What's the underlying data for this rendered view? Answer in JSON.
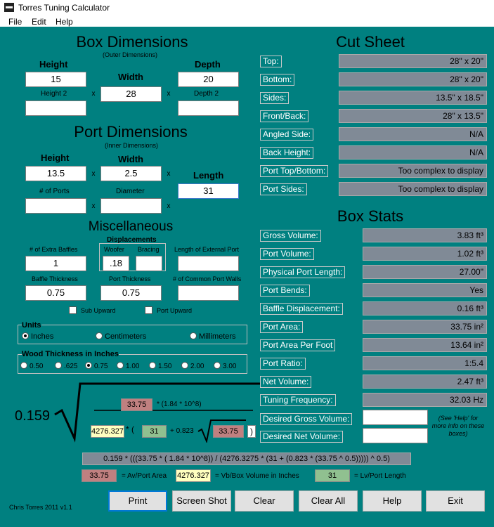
{
  "window": {
    "title": "Torres Tuning Calculator"
  },
  "menu": {
    "file": "File",
    "edit": "Edit",
    "help": "Help"
  },
  "box": {
    "title": "Box Dimensions",
    "subtitle": "(Outer Dimensions)",
    "height_label": "Height",
    "width_label": "Width",
    "depth_label": "Depth",
    "height2_label": "Height 2",
    "depth2_label": "Depth 2",
    "height": "15",
    "width": "28",
    "depth": "20",
    "height2": "",
    "depth2": "",
    "x": "x"
  },
  "port": {
    "title": "Port Dimensions",
    "subtitle": "(Inner Dimensions)",
    "height_label": "Height",
    "width_label": "Width",
    "length_label": "Length",
    "ports_label": "# of Ports",
    "diameter_label": "Diameter",
    "height": "13.5",
    "width": "2.5",
    "length": "31",
    "ports": "",
    "diameter": ""
  },
  "misc": {
    "title": "Miscellaneous",
    "displacements": "Displacements",
    "extra_baffles_label": "# of Extra Baffles",
    "woofer_label": "Woofer",
    "bracing_label": "Bracing",
    "ext_port_label": "Length of External Port",
    "baffle_thick_label": "Baffle Thickness",
    "port_thick_label": "Port Thickness",
    "common_walls_label": "# of Common Port Walls",
    "extra_baffles": "1",
    "woofer": ".18",
    "bracing": "",
    "ext_port": "",
    "baffle_thick": "0.75",
    "port_thick": "0.75",
    "common_walls": "",
    "sub_upward": "Sub Upward",
    "port_upward": "Port Upward"
  },
  "units": {
    "title": "Units",
    "options": [
      "Inches",
      "Centimeters",
      "Millimeters"
    ],
    "selected": "Inches"
  },
  "wood": {
    "title": "Wood Thickness in Inches",
    "options": [
      "0.50",
      ".625",
      "0.75",
      "1.00",
      "1.50",
      "2.00",
      "3.00"
    ],
    "selected": "0.75"
  },
  "cut": {
    "title": "Cut Sheet",
    "rows": [
      {
        "label": "Top:",
        "value": "28\" x 20\""
      },
      {
        "label": "Bottom:",
        "value": "28\" x 20\""
      },
      {
        "label": "Sides:",
        "value": "13.5\" x 18.5\""
      },
      {
        "label": "Front/Back:",
        "value": "28\" x 13.5\""
      },
      {
        "label": "Angled Side:",
        "value": "N/A"
      },
      {
        "label": "Back Height:",
        "value": "N/A"
      },
      {
        "label": "Port Top/Bottom:",
        "value": "Too complex to display"
      },
      {
        "label": "Port Sides:",
        "value": "Too complex to display"
      }
    ]
  },
  "stats": {
    "title": "Box Stats",
    "rows": [
      {
        "label": "Gross Volume:",
        "value": "3.83 ft³"
      },
      {
        "label": "Port Volume:",
        "value": "1.02 ft³"
      },
      {
        "label": "Physical Port Length:",
        "value": "27.00\""
      },
      {
        "label": "Port Bends:",
        "value": "Yes"
      },
      {
        "label": "Baffle Displacement:",
        "value": "0.16 ft³"
      },
      {
        "label": "Port Area:",
        "value": "33.75 in²"
      },
      {
        "label": "Port Area Per Foot",
        "value": "13.64 in²"
      },
      {
        "label": "Port Ratio:",
        "value": "1:5.4"
      },
      {
        "label": "Net Volume:",
        "value": "2.47 ft³"
      },
      {
        "label": "Tuning Frequency:",
        "value": "32.03 Hz"
      }
    ],
    "desired_gross": "Desired Gross Volume:",
    "desired_net": "Desired Net Volume:",
    "help_note": "(See 'Help' for more info on these boxes)"
  },
  "formula": {
    "const": "0.159",
    "av": "33.75",
    "factor": "* (1.84 * 10^8)",
    "vb": "4276.327",
    "open": "* (",
    "lv": "31",
    "plus": "+ 0.823",
    "av2": "33.75",
    "close": ")",
    "text": "0.159 * (((33.75 * ( 1.84 * 10^8)) / (4276.3275 * (31 + (0.823 * (33.75 ^ 0.5))))) ^ 0.5)",
    "legend_av": "33.75",
    "legend_av_text": "= Av/Port Area",
    "legend_vb": "4276.327",
    "legend_vb_text": "= Vb/Box Volume in Inches",
    "legend_lv": "31",
    "legend_lv_text": "= Lv/Port Length"
  },
  "footer": {
    "credit": "Chris Torres 2011 v1.1"
  },
  "buttons": {
    "print": "Print",
    "screenshot": "Screen Shot",
    "clear": "Clear",
    "clear_all": "Clear All",
    "help": "Help",
    "exit": "Exit"
  }
}
